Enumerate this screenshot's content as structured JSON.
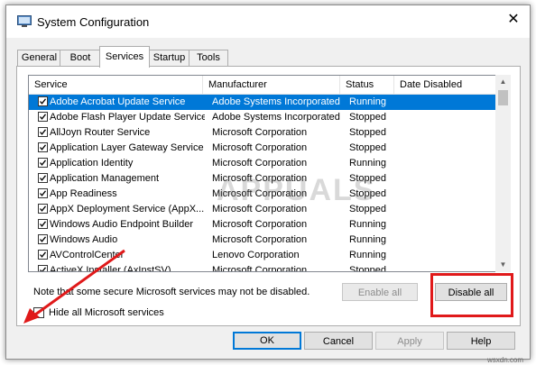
{
  "window": {
    "title": "System Configuration",
    "close_glyph": "✕"
  },
  "tabs": [
    {
      "label": "General"
    },
    {
      "label": "Boot"
    },
    {
      "label": "Services",
      "active": true
    },
    {
      "label": "Startup"
    },
    {
      "label": "Tools"
    }
  ],
  "list": {
    "columns": [
      "Service",
      "Manufacturer",
      "Status",
      "Date Disabled"
    ],
    "rows": [
      {
        "service": "Adobe Acrobat Update Service",
        "manufacturer": "Adobe Systems Incorporated",
        "status": "Running",
        "date_disabled": "",
        "checked": true,
        "selected": true
      },
      {
        "service": "Adobe Flash Player Update Service",
        "manufacturer": "Adobe Systems Incorporated",
        "status": "Stopped",
        "date_disabled": "",
        "checked": true
      },
      {
        "service": "AllJoyn Router Service",
        "manufacturer": "Microsoft Corporation",
        "status": "Stopped",
        "date_disabled": "",
        "checked": true
      },
      {
        "service": "Application Layer Gateway Service",
        "manufacturer": "Microsoft Corporation",
        "status": "Stopped",
        "date_disabled": "",
        "checked": true
      },
      {
        "service": "Application Identity",
        "manufacturer": "Microsoft Corporation",
        "status": "Running",
        "date_disabled": "",
        "checked": true
      },
      {
        "service": "Application Management",
        "manufacturer": "Microsoft Corporation",
        "status": "Stopped",
        "date_disabled": "",
        "checked": true
      },
      {
        "service": "App Readiness",
        "manufacturer": "Microsoft Corporation",
        "status": "Stopped",
        "date_disabled": "",
        "checked": true
      },
      {
        "service": "AppX Deployment Service (AppX...",
        "manufacturer": "Microsoft Corporation",
        "status": "Stopped",
        "date_disabled": "",
        "checked": true
      },
      {
        "service": "Windows Audio Endpoint Builder",
        "manufacturer": "Microsoft Corporation",
        "status": "Running",
        "date_disabled": "",
        "checked": true
      },
      {
        "service": "Windows Audio",
        "manufacturer": "Microsoft Corporation",
        "status": "Running",
        "date_disabled": "",
        "checked": true
      },
      {
        "service": "AVControlCenter",
        "manufacturer": "Lenovo Corporation",
        "status": "Running",
        "date_disabled": "",
        "checked": true
      },
      {
        "service": "ActiveX Installer (AxInstSV)",
        "manufacturer": "Microsoft Corporation",
        "status": "Stopped",
        "date_disabled": "",
        "checked": true
      }
    ]
  },
  "note": "Note that some secure Microsoft services may not be disabled.",
  "hide_ms": {
    "label": "Hide all Microsoft services",
    "checked": false
  },
  "buttons": {
    "enable_all": "Enable all",
    "disable_all": "Disable all",
    "ok": "OK",
    "cancel": "Cancel",
    "apply": "Apply",
    "help": "Help"
  },
  "watermark": "APPUALS",
  "credit": "wsxdn.com",
  "colors": {
    "selection": "#0078d7",
    "highlight_box": "#e0191a",
    "arrow": "#e0191a"
  },
  "icons": {
    "app": "msconfig-icon",
    "close": "close-icon",
    "checkbox": "checkmark-icon",
    "scroll_up": "scroll-up-icon",
    "scroll_down": "scroll-down-icon"
  }
}
